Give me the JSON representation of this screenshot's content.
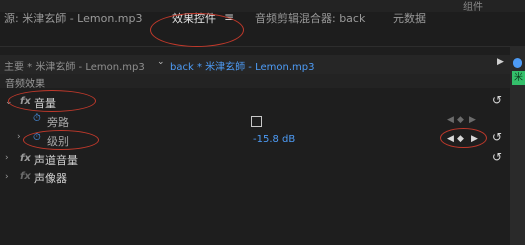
{
  "top_bar": {
    "group_label": "组件"
  },
  "tabs": [
    {
      "label": "源: 米津玄師 - Lemon.mp3",
      "active": false
    },
    {
      "label": "效果控件",
      "active": true
    },
    {
      "label": "音频剪辑混合器: back",
      "active": false
    },
    {
      "label": "元数据",
      "active": false
    }
  ],
  "tab_menu_icon": "hamburger-icon",
  "clip_bar": {
    "source": "主要 * 米津玄師 - Lemon.mp3",
    "target": "back * 米津玄師 - Lemon.mp3",
    "dropdown_icon": "chevron-down-icon",
    "play_icon": "play-arrow-icon"
  },
  "side_tag": "米",
  "section": {
    "title": "音频效果"
  },
  "effects": [
    {
      "name": "音量",
      "fx": "fx",
      "expanded": true
    },
    {
      "name": "旁路",
      "kind": "checkbox",
      "checked": false
    },
    {
      "name": "级别",
      "value": "-15.8 dB"
    },
    {
      "name": "声道音量",
      "fx": "fx"
    },
    {
      "name": "声像器",
      "fx": "fx"
    }
  ],
  "icons": {
    "reset": "↺",
    "stopwatch": "⏱",
    "kf_prev": "◀",
    "kf_add": "◆",
    "kf_next": "▶"
  },
  "accent": {
    "blue": "#4d9bf5",
    "green": "#34c06b",
    "annotation_red": "#c0392b"
  }
}
